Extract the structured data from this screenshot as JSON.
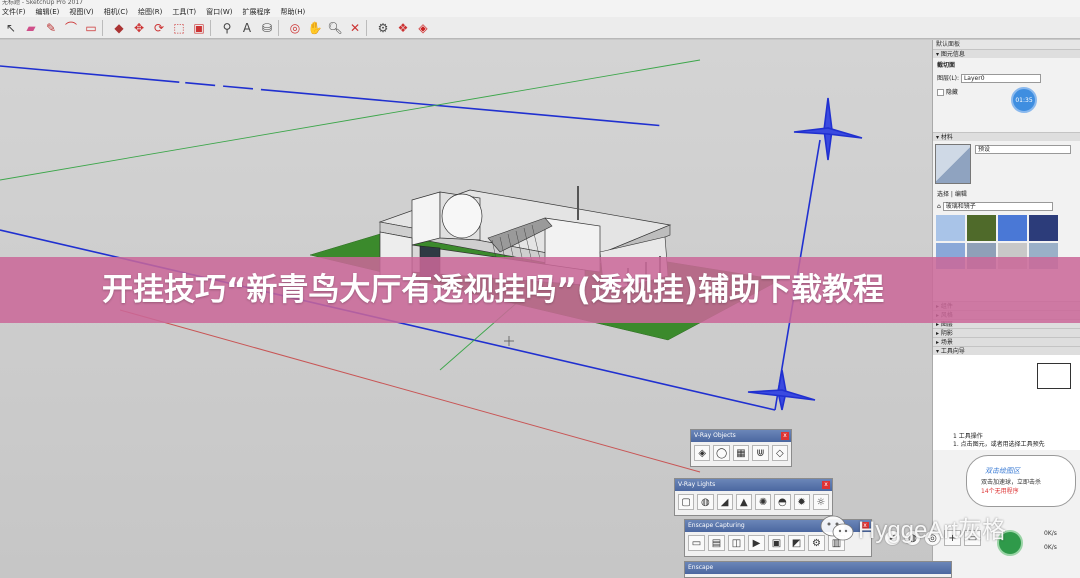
{
  "window": {
    "title": "无标题 - SketchUp Pro 2017"
  },
  "menu": [
    "文件(F)",
    "编辑(E)",
    "视图(V)",
    "相机(C)",
    "绘图(R)",
    "工具(T)",
    "窗口(W)",
    "扩展程序",
    "帮助(H)"
  ],
  "toolbar_icons": [
    "select-icon",
    "eraser-icon",
    "pencil-icon",
    "arc-icon",
    "shape-icon",
    "pushpull-icon",
    "move-icon",
    "rotate-icon",
    "scale-icon",
    "offset-icon",
    "tape-icon",
    "text-icon",
    "paint-icon",
    "orbit-icon",
    "pan-icon",
    "zoom-icon",
    "zoom-extents-icon",
    "warehouse-icon",
    "extension-icon",
    "ruby-icon"
  ],
  "tray": {
    "title": "默认面板",
    "entity_info": {
      "header": "图元信息",
      "section_label": "截切面",
      "layer_label": "图层(L):",
      "layer_value": "Layer0",
      "hidden_label": "隐藏"
    },
    "materials": {
      "header": "材料",
      "name_placeholder": "预设",
      "tab_select": "选择",
      "tab_edit": "编辑",
      "category": "玻璃和镜子"
    },
    "collapsed_sections": [
      "组件",
      "风格",
      "图层",
      "阴影",
      "场景"
    ],
    "instructor": {
      "header": "工具向导",
      "line1": "1 工具操作",
      "line2": "1. 点击图元，或者用选择工具预先"
    },
    "clock": "01:35",
    "tips": {
      "title": "双击绘图区",
      "line1": "双击加速球，立即击杀",
      "line2": "14个无用程序"
    }
  },
  "palettes": {
    "vray_objects": "V-Ray Objects",
    "vray_lights": "V-Ray Lights",
    "enscape_capturing": "Enscape Capturing",
    "enscape": "Enscape",
    "enscape_speed_top": "0K/s",
    "enscape_speed_bottom": "0K/s"
  },
  "banner": {
    "text": "开挂技巧“新青鸟大厅有透视挂吗”(透视挂)辅助下载教程"
  },
  "watermark": {
    "text": "HyggeArt灰格"
  },
  "colors": {
    "banner": "#cb6898",
    "axis_blue": "#1f2fd0",
    "axis_red": "#c44",
    "axis_green": "#4caf50",
    "ground": "#3b8a2c"
  }
}
